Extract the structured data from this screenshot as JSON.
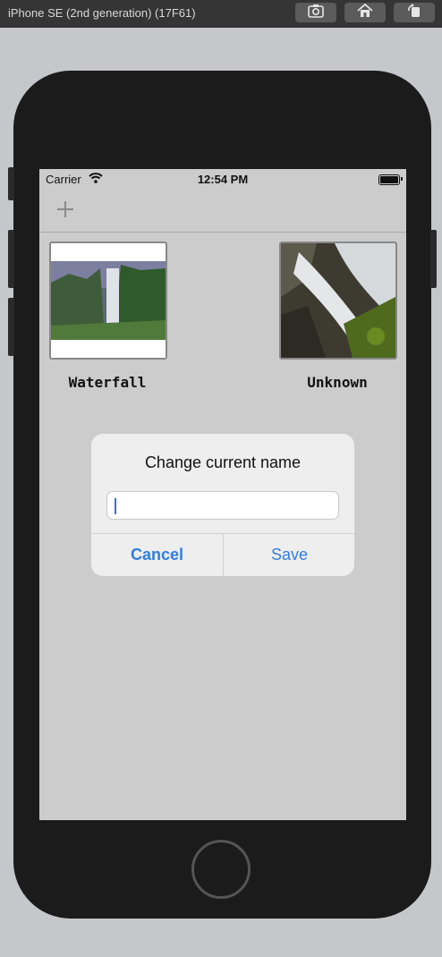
{
  "simulator": {
    "title": "iPhone SE (2nd generation) (17F61)",
    "buttons": [
      "screenshot-icon",
      "home-icon",
      "rotate-icon"
    ]
  },
  "status_bar": {
    "carrier": "Carrier",
    "time": "12:54 PM"
  },
  "nav_bar": {
    "add_icon": "plus-icon"
  },
  "cells": [
    {
      "label": "Waterfall"
    },
    {
      "label": "Unknown"
    }
  ],
  "alert": {
    "title": "Change current name",
    "field_value": "",
    "cancel_label": "Cancel",
    "save_label": "Save"
  },
  "colors": {
    "accent": "#2f7de1",
    "screen_bg": "#cccccc",
    "device": "#1b1b1b"
  }
}
